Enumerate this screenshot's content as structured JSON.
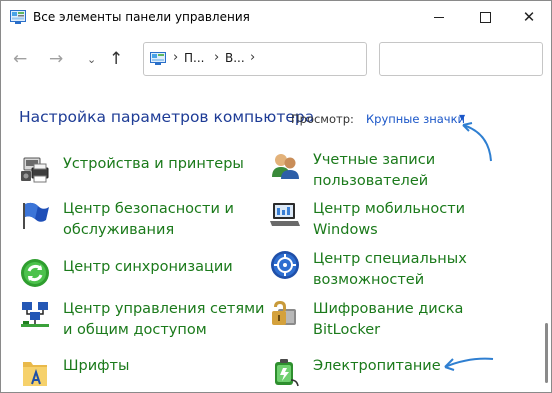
{
  "window": {
    "title": "Все элементы панели управления",
    "minimize_glyph": "—",
    "maximize_glyph": "□",
    "close_glyph": "✕"
  },
  "nav": {
    "back_glyph": "←",
    "forward_glyph": "→",
    "recent_glyph": "⌄",
    "up_glyph": "↑",
    "breadcrumbs": [
      "П...",
      "В..."
    ],
    "separator": "›",
    "search_placeholder": ""
  },
  "header": {
    "title": "Настройка параметров компьютера",
    "view_label": "Просмотр:",
    "view_value": "Крупные значки",
    "view_caret": "▼"
  },
  "colors": {
    "accent": "#1a56c8",
    "link_green": "#1b7a1b",
    "title_blue": "#1e3c96",
    "annotation_arrow": "#2f7fd1"
  },
  "items": [
    {
      "line1": "Устройства и принтеры",
      "line2": "",
      "icon": "printer-icon"
    },
    {
      "line1": "Учетные записи",
      "line2": "пользователей",
      "icon": "users-icon"
    },
    {
      "line1": "Центр безопасности и",
      "line2": "обслуживания",
      "icon": "flag-icon"
    },
    {
      "line1": "Центр мобильности",
      "line2": "Windows",
      "icon": "mobility-icon"
    },
    {
      "line1": "Центр синхронизации",
      "line2": "",
      "icon": "sync-icon"
    },
    {
      "line1": "Центр специальных",
      "line2": "возможностей",
      "icon": "accessibility-icon"
    },
    {
      "line1": "Центр управления сетями",
      "line2": "и общим доступом",
      "icon": "network-icon"
    },
    {
      "line1": "Шифрование диска",
      "line2": "BitLocker",
      "icon": "bitlocker-icon"
    },
    {
      "line1": "Шрифты",
      "line2": "",
      "icon": "fonts-icon"
    },
    {
      "line1": "Электропитание",
      "line2": "",
      "icon": "power-icon"
    }
  ]
}
